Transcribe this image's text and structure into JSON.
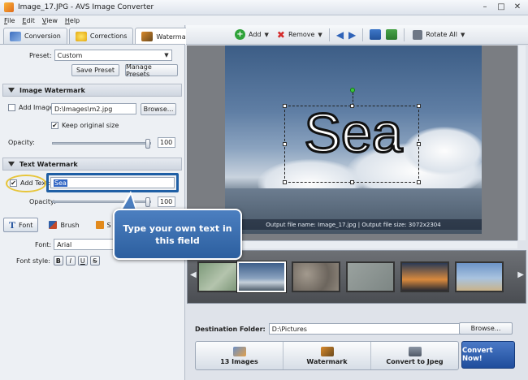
{
  "window": {
    "title": "Image_17.JPG - AVS Image Converter"
  },
  "menu": [
    "File",
    "Edit",
    "View",
    "Help"
  ],
  "tabs": [
    {
      "label": "Conversion"
    },
    {
      "label": "Corrections"
    },
    {
      "label": "Watermark"
    }
  ],
  "preset": {
    "label": "Preset:",
    "value": "Custom",
    "save": "Save Preset",
    "manage": "Manage Presets"
  },
  "image_watermark": {
    "header": "Image Watermark",
    "add_image_label": "Add Image:",
    "path": "D:\\Images\\m2.jpg",
    "browse": "Browse...",
    "keep_original": "Keep original size",
    "opacity_label": "Opacity:",
    "opacity_value": "100"
  },
  "text_watermark": {
    "header": "Text Watermark",
    "add_text_label": "Add Text:",
    "text_value": "Sea",
    "opacity_label": "Opacity:",
    "opacity_value": "100",
    "tools": [
      "Font",
      "Brush",
      "S"
    ],
    "font_label": "Font:",
    "font_value": "Arial",
    "font_style_label": "Font style:",
    "font_styles": [
      "B",
      "I",
      "U",
      "S"
    ]
  },
  "toolbar": {
    "add": "Add",
    "remove": "Remove",
    "rotate_all": "Rotate All"
  },
  "preview": {
    "watermark_text": "Sea",
    "info": "Output file name: Image_17.jpg | Output file size: 3072x2304"
  },
  "destination": {
    "label": "Destination Folder:",
    "path": "D:\\Pictures",
    "browse": "Browse..."
  },
  "steps": [
    {
      "label": "13 Images"
    },
    {
      "label": "Watermark"
    },
    {
      "label": "Convert to Jpeg"
    }
  ],
  "convert_button": "Convert Now!",
  "callout": {
    "text": "Type your own text in this field"
  },
  "colors": {
    "accent": "#2c5f9f",
    "highlight_ring": "#e7c53a"
  }
}
